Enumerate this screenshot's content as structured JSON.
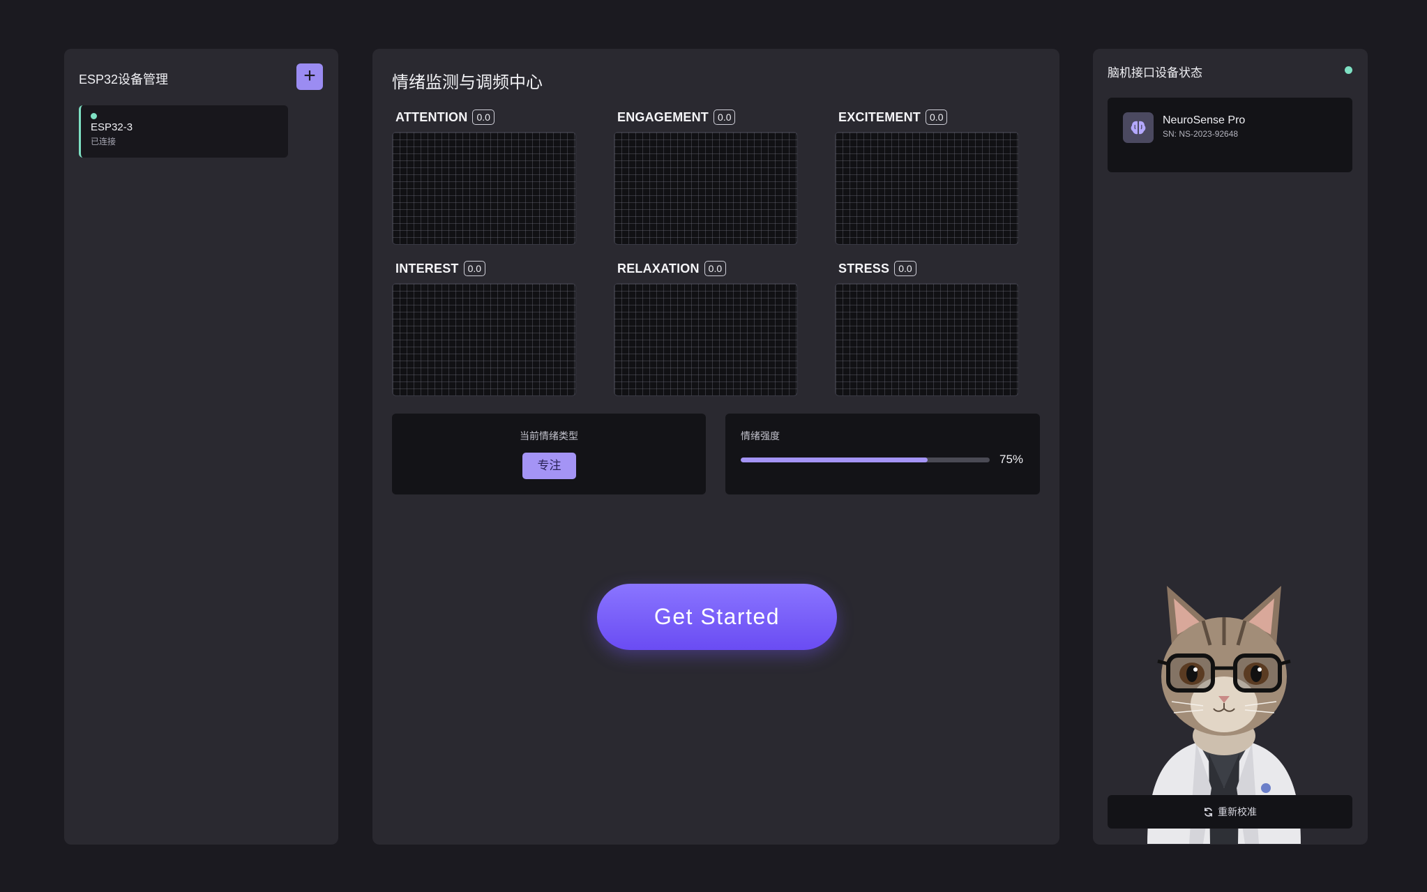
{
  "left_panel": {
    "title": "ESP32设备管理",
    "add_label": "+",
    "devices": [
      {
        "name": "ESP32-3",
        "status": "已连接",
        "status_color": "#7ee0c3"
      }
    ]
  },
  "center_panel": {
    "title": "情绪监测与调频中心",
    "metrics": [
      {
        "label": "ATTENTION",
        "value": "0.0"
      },
      {
        "label": "ENGAGEMENT",
        "value": "0.0"
      },
      {
        "label": "EXCITEMENT",
        "value": "0.0"
      },
      {
        "label": "INTEREST",
        "value": "0.0"
      },
      {
        "label": "RELAXATION",
        "value": "0.0"
      },
      {
        "label": "STRESS",
        "value": "0.0"
      }
    ],
    "emotion_type": {
      "label": "当前情绪类型",
      "value": "专注"
    },
    "intensity": {
      "label": "情绪强度",
      "percent": 75,
      "text": "75%"
    },
    "start_button": "Get Started"
  },
  "right_panel": {
    "title": "脑机接口设备状态",
    "status_color": "#7ee0c3",
    "device": {
      "icon": "brain-icon",
      "name": "NeuroSense Pro",
      "sn": "SN: NS-2023-92648"
    },
    "mascot": "cat-scientist-illustration",
    "recalibrate_icon": "refresh-icon",
    "recalibrate_label": "重新校准"
  },
  "colors": {
    "accent": "#a494f5",
    "button_gradient_top": "#8a75ff",
    "online": "#7ee0c3",
    "background": "#1b1a20",
    "panel": "#2a2930"
  }
}
